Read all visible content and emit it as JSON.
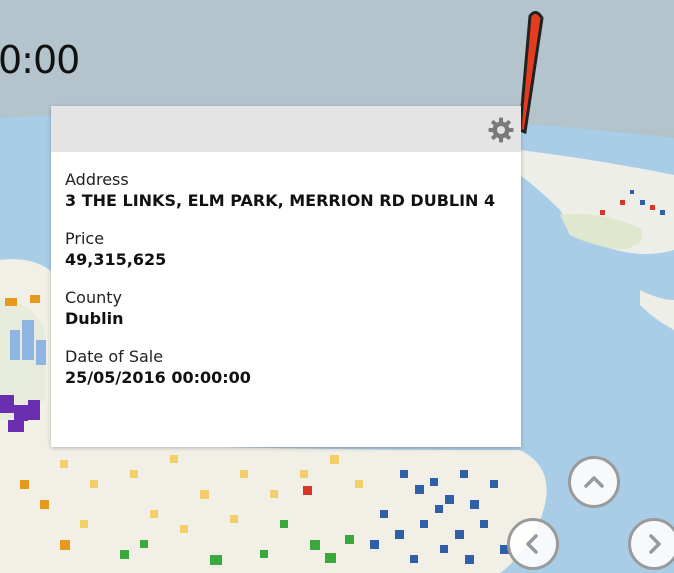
{
  "clock": {
    "time_text": "0:00"
  },
  "tooltip": {
    "fields": [
      {
        "label": "Address",
        "value": "3 THE LINKS, ELM PARK, MERRION RD DUBLIN 4"
      },
      {
        "label": "Price",
        "value": "49,315,625"
      },
      {
        "label": "County",
        "value": "Dublin"
      },
      {
        "label": "Date of Sale",
        "value": "25/05/2016 00:00:00"
      }
    ],
    "settings_icon": "gear-icon"
  },
  "navigation": {
    "up_icon": "chevron-up-icon",
    "left_icon": "chevron-left-icon",
    "right_icon": "chevron-right-icon"
  },
  "colors": {
    "sky": "#b4c4cc",
    "sea": "#a9cde6",
    "land": "#f1f0ea",
    "pin": "#e43c1e",
    "card_header": "#e4e4e4"
  }
}
